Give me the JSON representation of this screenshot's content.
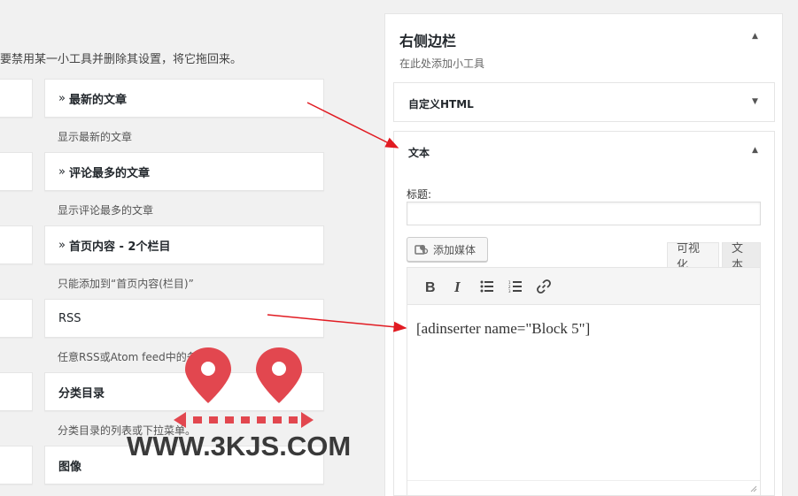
{
  "left_panel": {
    "instructions": "要禁用某一小工具并删除其设置，将它拖回来。",
    "available_widgets": [
      {
        "name": "最新的文章",
        "prefix": "»",
        "description": "显示最新的文章"
      },
      {
        "name": "评论最多的文章",
        "prefix": "»",
        "description": "显示评论最多的文章"
      },
      {
        "name": "首页内容 - 2个栏目",
        "prefix": "»",
        "description": "只能添加到“首页内容(栏目)”"
      },
      {
        "name": "RSS",
        "prefix": "",
        "description": "任意RSS或Atom feed中的条目。"
      },
      {
        "name": "分类目录",
        "prefix": "",
        "description": "分类目录的列表或下拉菜单。"
      },
      {
        "name": "图像",
        "prefix": "",
        "description": ""
      }
    ]
  },
  "sidebar": {
    "title": "右侧边栏",
    "description": "在此处添加小工具",
    "widgets": [
      {
        "title": "自定义HTML"
      },
      {
        "title": "文本"
      }
    ]
  },
  "text_widget": {
    "title_label": "标题:",
    "title_value": "",
    "add_media_label": "添加媒体",
    "tabs": [
      "可视化",
      "文本"
    ],
    "content": "[adinserter name=\"Block 5\"]"
  },
  "toolbar": {
    "icons": [
      "bold-icon",
      "italic-icon",
      "bullet-list-icon",
      "numbered-list-icon",
      "link-icon"
    ]
  },
  "watermark": {
    "text": "WWW.3KJS.COM"
  },
  "colors": {
    "accent_red": "#e2474f",
    "arrow_red": "#e11b22"
  }
}
